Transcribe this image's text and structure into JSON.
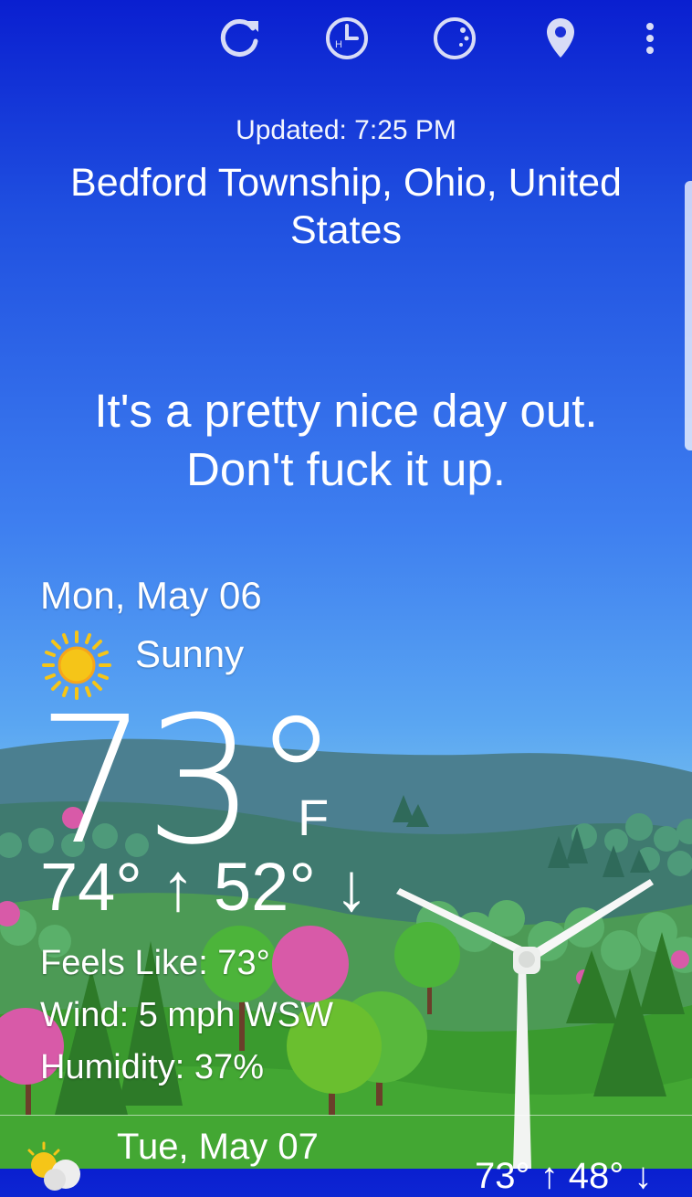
{
  "toolbar": {
    "refresh_icon": "refresh-icon",
    "hourly_icon": "hourly-clock-icon",
    "hourly_badge": "H",
    "moon_icon": "moon-phase-icon",
    "location_icon": "location-pin-icon",
    "menu_icon": "more-vert-icon"
  },
  "updated": "Updated: 7:25 PM",
  "location": "Bedford Township, Ohio, United States",
  "message": "It's a pretty nice day out. Don't fuck it up.",
  "today": {
    "date": "Mon, May 06",
    "condition": "Sunny",
    "condition_icon": "sun-icon",
    "temp": "73°",
    "unit": "F",
    "hilo": "74° ↑ 52° ↓",
    "feels_like": "Feels Like: 73°",
    "wind": "Wind: 5 mph WSW",
    "humidity": "Humidity: 37%"
  },
  "next": {
    "date": "Tue, May 07",
    "condition_icon": "partly-cloudy-icon",
    "temps": "73° ↑ 48° ↓"
  },
  "colors": {
    "sky_top": "#0a1fd0",
    "sky_bottom": "#6fb8ef",
    "grass": "#3a9a2e",
    "sun": "#f5c518"
  }
}
